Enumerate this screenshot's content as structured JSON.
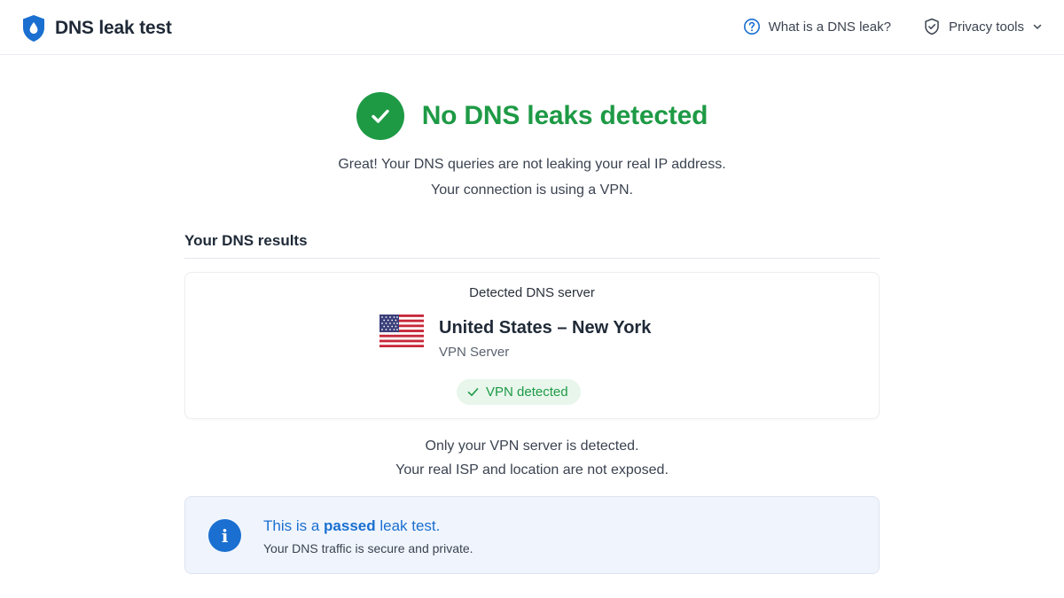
{
  "header": {
    "title": "DNS leak test",
    "nav": [
      {
        "label": "What is a DNS leak?",
        "icon": "help-circle-icon"
      },
      {
        "label": "Privacy tools",
        "icon": "shield-check-icon",
        "has_dropdown": true
      }
    ]
  },
  "status": {
    "title": "No DNS leaks detected",
    "line1": "Great! Your DNS queries are not leaking your real IP address.",
    "line2": "Your connection is using a VPN.",
    "color": "#1e9a45"
  },
  "results": {
    "section_title": "Your DNS results",
    "card_label": "Detected DNS server",
    "flag": "us-flag-icon",
    "location": "United States – New York",
    "server_type": "VPN Server",
    "badge": "VPN detected"
  },
  "summary": {
    "line1": "Only your VPN server is detected.",
    "line2": "Your real ISP and location are not exposed."
  },
  "info": {
    "title_prefix": "This is a ",
    "title_bold": "passed",
    "title_suffix": " leak test.",
    "subtitle": "Your DNS traffic is secure and private.",
    "color": "#1a6fd0"
  }
}
